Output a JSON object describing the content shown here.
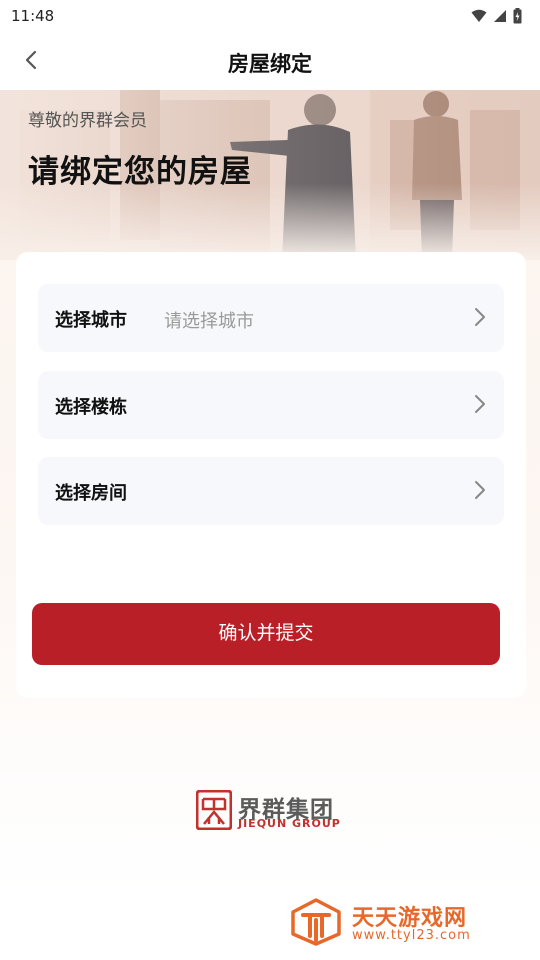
{
  "status_bar": {
    "time": "11:48"
  },
  "header": {
    "title": "房屋绑定"
  },
  "hero": {
    "greeting": "尊敬的界群会员",
    "title": "请绑定您的房屋"
  },
  "form": {
    "rows": [
      {
        "label": "选择城市",
        "placeholder": "请选择城市"
      },
      {
        "label": "选择楼栋",
        "placeholder": ""
      },
      {
        "label": "选择房间",
        "placeholder": ""
      }
    ],
    "submit_label": "确认并提交"
  },
  "brand": {
    "name_cn": "界群集团",
    "name_en": "JIEQUN GROUP"
  },
  "watermark": {
    "name_cn": "天天游戏网",
    "url": "www.ttyl23.com"
  },
  "colors": {
    "primary": "#b91f26",
    "brand_red": "#c3312f",
    "watermark_orange": "#e8682a"
  },
  "icons": [
    "wifi-icon",
    "signal-icon",
    "battery-icon",
    "back-arrow-icon",
    "chevron-right-icon"
  ]
}
